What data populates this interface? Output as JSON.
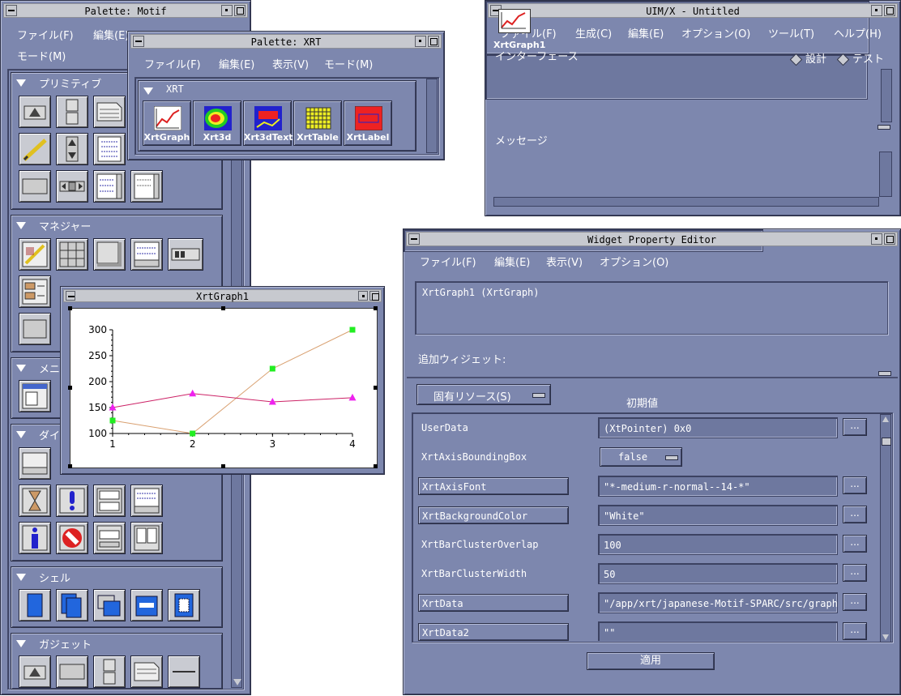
{
  "palette_motif": {
    "title": "Palette: Motif",
    "menu": [
      "ファイル(F)",
      "編集(E)",
      "モード(M)"
    ],
    "sections": [
      "プリミティブ",
      "マネジャー",
      "メニュー",
      "ダイアログ",
      "シェル",
      "ガジェット"
    ]
  },
  "palette_xrt": {
    "title": "Palette: XRT",
    "menu": [
      "ファイル(F)",
      "編集(E)",
      "表示(V)",
      "モード(M)"
    ],
    "section": "XRT",
    "items": [
      "XrtGraph",
      "Xrt3d",
      "Xrt3dText",
      "XrtTable",
      "XrtLabel"
    ]
  },
  "uimx": {
    "title": "UIM/X - Untitled",
    "menu": [
      "ファイル(F)",
      "生成(C)",
      "編集(E)",
      "オプション(O)",
      "ツール(T)",
      "ヘルプ(H)"
    ],
    "interface_label": "インターフェース",
    "mode_design": "設計",
    "mode_test": "テスト",
    "item": "XrtGraph1",
    "message_label": "メッセージ"
  },
  "graph_window": {
    "title": "XrtGraph1",
    "chart_data": {
      "type": "line",
      "x": [
        1,
        2,
        3,
        4
      ],
      "series": [
        {
          "values": [
            125,
            100,
            225,
            300
          ],
          "color": "#d9a070",
          "marker_color": "#22ee22",
          "marker": "square"
        },
        {
          "values": [
            150,
            177,
            161,
            169
          ],
          "color": "#cc2266",
          "marker_color": "#ee22ee",
          "marker": "triangle"
        }
      ],
      "xlim": [
        1,
        4
      ],
      "ylim": [
        100,
        300
      ],
      "yticks": [
        100,
        150,
        200,
        250,
        300
      ],
      "xticks": [
        1,
        2,
        3,
        4
      ]
    }
  },
  "editor": {
    "title": "Widget Property Editor",
    "menu": [
      "ファイル(F)",
      "編集(E)",
      "表示(V)",
      "オプション(O)"
    ],
    "widget_desc": "XrtGraph1  (XrtGraph)",
    "add_widget_label": "追加ウィジェット:",
    "resource_menu": "固有リソース(S)",
    "initial_label": "初期値",
    "ellipsis": "...",
    "apply": "適用",
    "rows": [
      {
        "name": "UserData",
        "value": "(XtPointer) 0x0",
        "boxed": false,
        "type": "text"
      },
      {
        "name": "XrtAxisBoundingBox",
        "value": "false",
        "boxed": false,
        "type": "option"
      },
      {
        "name": "XrtAxisFont",
        "value": "\"*-medium-r-normal--14-*\"",
        "boxed": true,
        "type": "text"
      },
      {
        "name": "XrtBackgroundColor",
        "value": "\"White\"",
        "boxed": true,
        "type": "text"
      },
      {
        "name": "XrtBarClusterOverlap",
        "value": "100",
        "boxed": false,
        "type": "text"
      },
      {
        "name": "XrtBarClusterWidth",
        "value": "50",
        "boxed": false,
        "type": "text"
      },
      {
        "name": "XrtData",
        "value": "\"/app/xrt/japanese-Motif-SPARC/src/graph,",
        "boxed": true,
        "type": "text"
      },
      {
        "name": "XrtData2",
        "value": "\"\"",
        "boxed": true,
        "type": "text"
      }
    ]
  }
}
